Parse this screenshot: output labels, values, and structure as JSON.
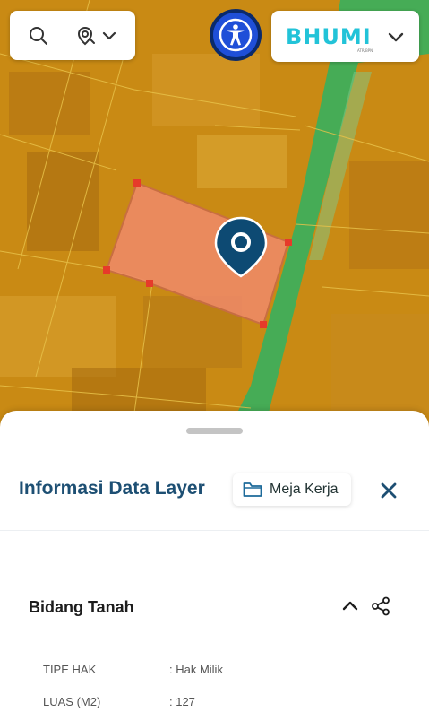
{
  "header": {
    "search_icon": "search-icon",
    "location_icon": "location-search-icon",
    "dropdown_icon": "chevron-down-icon",
    "accessibility_icon": "accessibility-icon",
    "brand": {
      "name": "BHUMI",
      "subtitle": "ATR/BPN"
    }
  },
  "colors": {
    "primary": "#1d4f73",
    "brand": "#22c3d8",
    "parcel_fill": "#f08a6a",
    "road_green": "#3fae5a",
    "map_base": "#c98a14",
    "marker": "#0d4a73",
    "accessibility_blue": "#1f4fd8"
  },
  "sheet": {
    "title": "Informasi Data Layer",
    "workspace_label": "Meja Kerja",
    "folder_icon": "folder-icon",
    "close_icon": "close-icon",
    "section": {
      "title": "Bidang Tanah",
      "collapse_icon": "chevron-up-icon",
      "share_icon": "share-icon",
      "attributes": [
        {
          "key": "TIPE HAK",
          "value": ": Hak Milik"
        },
        {
          "key": "LUAS (M2)",
          "value": ": 127"
        }
      ]
    }
  }
}
